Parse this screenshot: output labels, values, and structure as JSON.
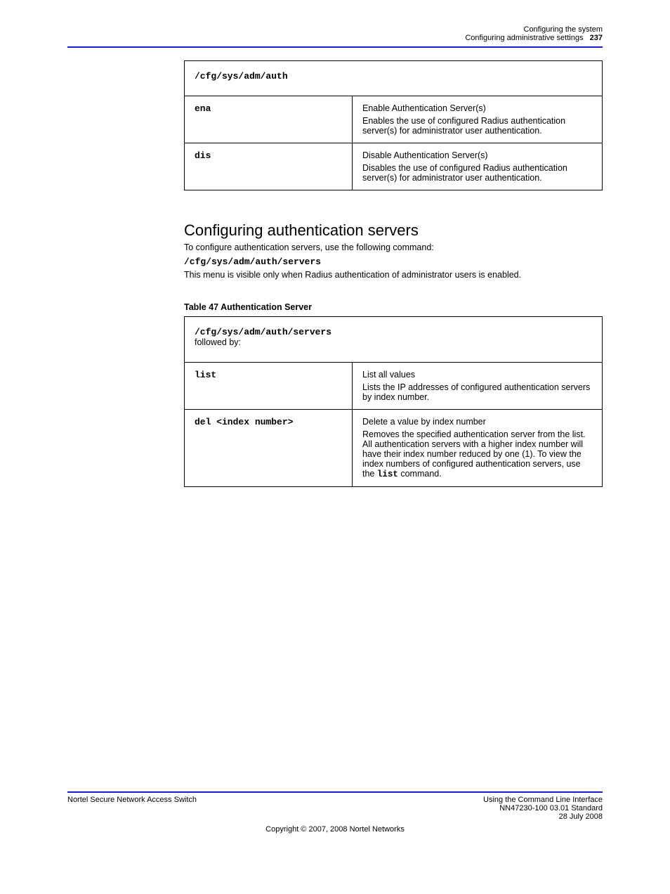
{
  "header": {
    "right_line1": "Configuring the system",
    "right_line2_label": "Configuring administrative settings",
    "right_line2_page": "237"
  },
  "table1": {
    "path": "/cfg/sys/adm/auth",
    "rows": [
      {
        "cmd": "ena",
        "lead": "Enable Authentication Server(s)",
        "body": "Enables the use of configured Radius authentication server(s) for administrator user authentication."
      },
      {
        "cmd": "dis",
        "lead": "Disable Authentication Server(s)",
        "body": "Disables the use of configured Radius authentication server(s) for administrator user authentication."
      }
    ]
  },
  "section": {
    "title": "Configuring authentication servers",
    "subtitle": "To configure authentication servers, use the following command:",
    "path": "/cfg/sys/adm/auth/servers",
    "after_path": "This menu is visible only when Radius authentication of administrator users is enabled."
  },
  "table2": {
    "caption": "Table 47   Authentication Server",
    "path": "/cfg/sys/adm/auth/servers",
    "after_path": "followed by:",
    "rows": [
      {
        "cmd": "list",
        "lead": "List all values",
        "body_html": "Lists the IP addresses of configured authentication servers by index number."
      },
      {
        "cmd": "del <index number>",
        "lead": "Delete a value by index number",
        "body_html": "Removes the specified authentication server from the list. All authentication servers with a higher index number will have their index number reduced by one (1). To view the index numbers of configured authentication servers, use the <span class=\"monob\">list</span> command."
      }
    ]
  },
  "footer": {
    "left": "Nortel Secure Network Access Switch",
    "right_line1": "Using the Command Line Interface",
    "right_line2": "NN47230-100  03.01 Standard",
    "right_line3": "28 July 2008",
    "copyright": "Copyright © 2007, 2008 Nortel Networks"
  }
}
